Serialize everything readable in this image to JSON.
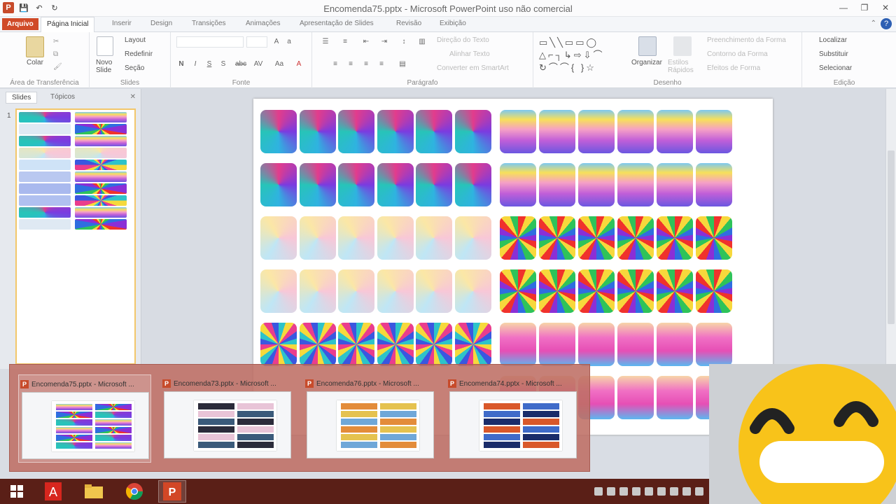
{
  "window": {
    "title": "Encomenda75.pptx - Microsoft PowerPoint uso não comercial"
  },
  "tabs": [
    "Arquivo",
    "Página Inicial",
    "Inserir",
    "Design",
    "Transições",
    "Animações",
    "Apresentação de Slides",
    "Revisão",
    "Exibição"
  ],
  "ribbon": {
    "clipboard": {
      "paste": "Colar",
      "label": "Área de Transferência"
    },
    "slides": {
      "new_slide": "Novo Slide",
      "layout": "Layout",
      "reset": "Redefinir",
      "section": "Seção",
      "label": "Slides"
    },
    "font": {
      "label": "Fonte"
    },
    "paragraph": {
      "text_direction": "Direção do Texto",
      "align_text": "Alinhar Texto",
      "smartart": "Converter em SmartArt",
      "label": "Parágrafo"
    },
    "drawing": {
      "arrange": "Organizar",
      "quick_styles": "Estilos Rápidos",
      "fill": "Preenchimento da Forma",
      "outline": "Contorno da Forma",
      "effects": "Efeitos de Forma",
      "label": "Desenho"
    },
    "editing": {
      "find": "Localizar",
      "replace": "Substituir",
      "select": "Selecionar",
      "label": "Edição"
    }
  },
  "panel": {
    "tab_slides": "Slides",
    "tab_outline": "Tópicos",
    "slide_number": "1"
  },
  "previews": [
    {
      "title": "Encomenda75.pptx - Microsoft ..."
    },
    {
      "title": "Encomenda73.pptx - Microsoft ..."
    },
    {
      "title": "Encomenda76.pptx - Microsoft ..."
    },
    {
      "title": "Encomenda74.pptx - Microsoft ..."
    }
  ],
  "colors": {
    "file_tab": "#d04a28",
    "taskbar": "#5a1f17",
    "emoji": "#f8c31a"
  },
  "icons": [
    "windows-start-icon",
    "adobe-icon",
    "folder-icon",
    "chrome-icon",
    "powerpoint-icon",
    "smiling-emoji-icon"
  ]
}
